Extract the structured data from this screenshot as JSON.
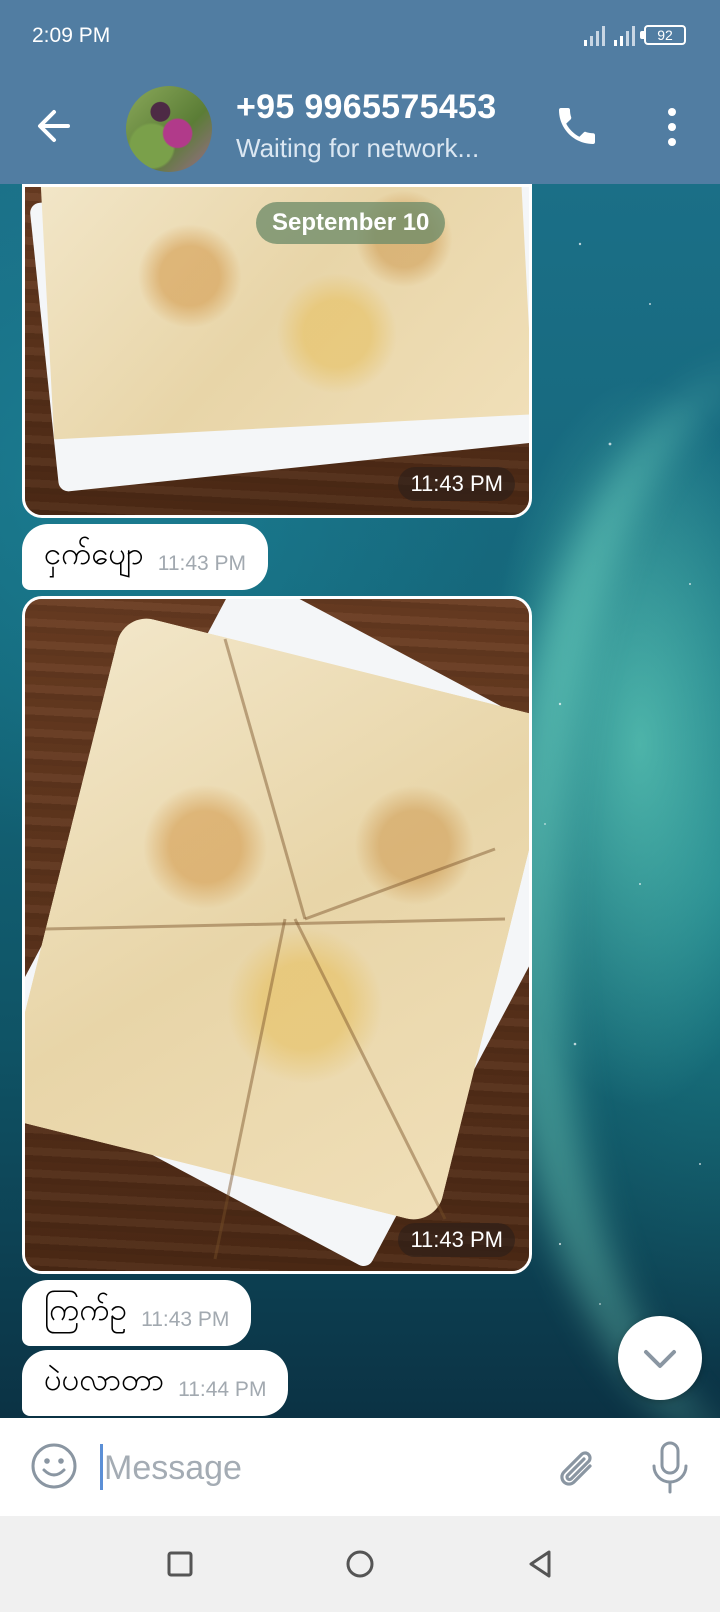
{
  "status_bar": {
    "time": "2:09 PM",
    "battery": "92"
  },
  "header": {
    "contact_name": "+95 9965575453",
    "contact_status": "Waiting for network..."
  },
  "chat": {
    "date_chip": "September 10",
    "messages": [
      {
        "type": "photo",
        "time": "11:43 PM"
      },
      {
        "type": "text",
        "text": "ငှက်ပျော",
        "time": "11:43 PM"
      },
      {
        "type": "photo",
        "time": "11:43 PM"
      },
      {
        "type": "text",
        "text": "ကြက်ဥ",
        "time": "11:43 PM"
      },
      {
        "type": "text",
        "text": "ပဲပလာတာ",
        "time": "11:44 PM"
      }
    ]
  },
  "input": {
    "placeholder": "Message",
    "value": ""
  },
  "icons": {
    "back": "arrow-left-icon",
    "call": "phone-icon",
    "menu": "more-vertical-icon",
    "scroll_down": "chevron-down-icon",
    "emoji": "smile-icon",
    "attach": "paperclip-icon",
    "mic": "microphone-icon",
    "nav_recents": "square-icon",
    "nav_home": "circle-icon",
    "nav_back": "triangle-back-icon"
  },
  "colors": {
    "header": "#517da2",
    "bubble": "#ffffff",
    "accent": "#5b8fd6"
  }
}
